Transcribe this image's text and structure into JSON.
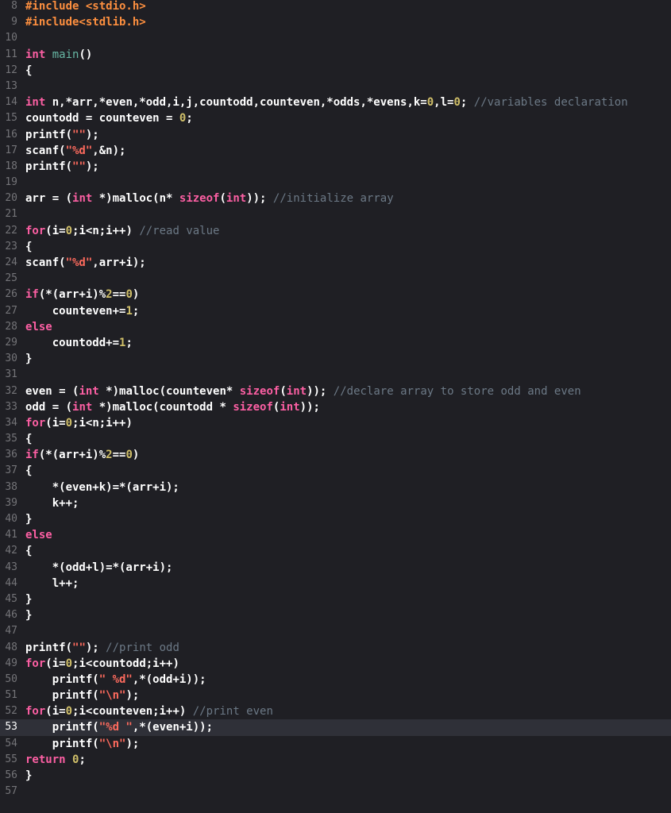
{
  "editor": {
    "current_line": 53,
    "lines": [
      {
        "n": "8",
        "t": [
          [
            "pp",
            "#include <stdio.h>"
          ]
        ]
      },
      {
        "n": "9",
        "t": [
          [
            "pp",
            "#include<stdlib.h>"
          ]
        ]
      },
      {
        "n": "10",
        "t": []
      },
      {
        "n": "11",
        "t": [
          [
            "kw",
            "int"
          ],
          [
            "pl",
            " "
          ],
          [
            "fn",
            "main"
          ],
          [
            "pl",
            "()"
          ]
        ]
      },
      {
        "n": "12",
        "t": [
          [
            "pl",
            "{"
          ]
        ]
      },
      {
        "n": "13",
        "t": []
      },
      {
        "n": "14",
        "t": [
          [
            "kw",
            "int"
          ],
          [
            "pl",
            " n,*arr,*even,*odd,i,j,countodd,counteven,*odds,*evens,k="
          ],
          [
            "num",
            "0"
          ],
          [
            "pl",
            ",l="
          ],
          [
            "num",
            "0"
          ],
          [
            "pl",
            "; "
          ],
          [
            "cm",
            "//variables declaration"
          ]
        ]
      },
      {
        "n": "15",
        "t": [
          [
            "pl",
            "countodd = counteven = "
          ],
          [
            "num",
            "0"
          ],
          [
            "pl",
            ";"
          ]
        ]
      },
      {
        "n": "16",
        "t": [
          [
            "pl",
            "printf("
          ],
          [
            "str",
            "\"\""
          ],
          [
            "pl",
            ");"
          ]
        ]
      },
      {
        "n": "17",
        "t": [
          [
            "pl",
            "scanf("
          ],
          [
            "str",
            "\"%d\""
          ],
          [
            "pl",
            ",&n);"
          ]
        ]
      },
      {
        "n": "18",
        "t": [
          [
            "pl",
            "printf("
          ],
          [
            "str",
            "\"\""
          ],
          [
            "pl",
            ");"
          ]
        ]
      },
      {
        "n": "19",
        "t": []
      },
      {
        "n": "20",
        "t": [
          [
            "pl",
            "arr = ("
          ],
          [
            "kw",
            "int"
          ],
          [
            "pl",
            " *)malloc(n* "
          ],
          [
            "kw",
            "sizeof"
          ],
          [
            "pl",
            "("
          ],
          [
            "kw",
            "int"
          ],
          [
            "pl",
            ")); "
          ],
          [
            "cm",
            "//initialize array"
          ]
        ]
      },
      {
        "n": "21",
        "t": []
      },
      {
        "n": "22",
        "t": [
          [
            "kw",
            "for"
          ],
          [
            "pl",
            "(i="
          ],
          [
            "num",
            "0"
          ],
          [
            "pl",
            ";i<n;i++) "
          ],
          [
            "cm",
            "//read value"
          ]
        ]
      },
      {
        "n": "23",
        "t": [
          [
            "pl",
            "{"
          ]
        ]
      },
      {
        "n": "24",
        "t": [
          [
            "pl",
            "scanf("
          ],
          [
            "str",
            "\"%d\""
          ],
          [
            "pl",
            ",arr+i);"
          ]
        ]
      },
      {
        "n": "25",
        "t": []
      },
      {
        "n": "26",
        "t": [
          [
            "kw",
            "if"
          ],
          [
            "pl",
            "(*(arr+i)%"
          ],
          [
            "num",
            "2"
          ],
          [
            "pl",
            "=="
          ],
          [
            "num",
            "0"
          ],
          [
            "pl",
            ")"
          ]
        ]
      },
      {
        "n": "27",
        "t": [
          [
            "pl",
            "    counteven+="
          ],
          [
            "num",
            "1"
          ],
          [
            "pl",
            ";"
          ]
        ]
      },
      {
        "n": "28",
        "t": [
          [
            "kw",
            "else"
          ]
        ]
      },
      {
        "n": "29",
        "t": [
          [
            "pl",
            "    countodd+="
          ],
          [
            "num",
            "1"
          ],
          [
            "pl",
            ";"
          ]
        ]
      },
      {
        "n": "30",
        "t": [
          [
            "pl",
            "}"
          ]
        ]
      },
      {
        "n": "31",
        "t": []
      },
      {
        "n": "32",
        "t": [
          [
            "pl",
            "even = ("
          ],
          [
            "kw",
            "int"
          ],
          [
            "pl",
            " *)malloc(counteven* "
          ],
          [
            "kw",
            "sizeof"
          ],
          [
            "pl",
            "("
          ],
          [
            "kw",
            "int"
          ],
          [
            "pl",
            ")); "
          ],
          [
            "cm",
            "//declare array to store odd and even"
          ]
        ]
      },
      {
        "n": "33",
        "t": [
          [
            "pl",
            "odd = ("
          ],
          [
            "kw",
            "int"
          ],
          [
            "pl",
            " *)malloc(countodd * "
          ],
          [
            "kw",
            "sizeof"
          ],
          [
            "pl",
            "("
          ],
          [
            "kw",
            "int"
          ],
          [
            "pl",
            "));"
          ]
        ]
      },
      {
        "n": "34",
        "t": [
          [
            "kw",
            "for"
          ],
          [
            "pl",
            "(i="
          ],
          [
            "num",
            "0"
          ],
          [
            "pl",
            ";i<n;i++)"
          ]
        ]
      },
      {
        "n": "35",
        "t": [
          [
            "pl",
            "{"
          ]
        ]
      },
      {
        "n": "36",
        "t": [
          [
            "kw",
            "if"
          ],
          [
            "pl",
            "(*(arr+i)%"
          ],
          [
            "num",
            "2"
          ],
          [
            "pl",
            "=="
          ],
          [
            "num",
            "0"
          ],
          [
            "pl",
            ")"
          ]
        ]
      },
      {
        "n": "37",
        "t": [
          [
            "pl",
            "{"
          ]
        ]
      },
      {
        "n": "38",
        "t": [
          [
            "pl",
            "    *(even+k)=*(arr+i);"
          ]
        ]
      },
      {
        "n": "39",
        "t": [
          [
            "pl",
            "    k++;"
          ]
        ]
      },
      {
        "n": "40",
        "t": [
          [
            "pl",
            "}"
          ]
        ]
      },
      {
        "n": "41",
        "t": [
          [
            "kw",
            "else"
          ]
        ]
      },
      {
        "n": "42",
        "t": [
          [
            "pl",
            "{"
          ]
        ]
      },
      {
        "n": "43",
        "t": [
          [
            "pl",
            "    *(odd+l)=*(arr+i);"
          ]
        ]
      },
      {
        "n": "44",
        "t": [
          [
            "pl",
            "    l++;"
          ]
        ]
      },
      {
        "n": "45",
        "t": [
          [
            "pl",
            "}"
          ]
        ]
      },
      {
        "n": "46",
        "t": [
          [
            "pl",
            "}"
          ]
        ]
      },
      {
        "n": "47",
        "t": []
      },
      {
        "n": "48",
        "t": [
          [
            "pl",
            "printf("
          ],
          [
            "str",
            "\"\""
          ],
          [
            "pl",
            "); "
          ],
          [
            "cm",
            "//print odd"
          ]
        ]
      },
      {
        "n": "49",
        "t": [
          [
            "kw",
            "for"
          ],
          [
            "pl",
            "(i="
          ],
          [
            "num",
            "0"
          ],
          [
            "pl",
            ";i<countodd;i++)"
          ]
        ]
      },
      {
        "n": "50",
        "t": [
          [
            "pl",
            "    printf("
          ],
          [
            "str",
            "\" %d\""
          ],
          [
            "pl",
            ",*(odd+i));"
          ]
        ]
      },
      {
        "n": "51",
        "t": [
          [
            "pl",
            "    printf("
          ],
          [
            "str",
            "\"\\n\""
          ],
          [
            "pl",
            ");"
          ]
        ]
      },
      {
        "n": "52",
        "t": [
          [
            "kw",
            "for"
          ],
          [
            "pl",
            "(i="
          ],
          [
            "num",
            "0"
          ],
          [
            "pl",
            ";i<counteven;i++) "
          ],
          [
            "cm",
            "//print even"
          ]
        ]
      },
      {
        "n": "53",
        "t": [
          [
            "pl",
            "    printf("
          ],
          [
            "str",
            "\"%d \""
          ],
          [
            "pl",
            ",*(even+i));"
          ]
        ]
      },
      {
        "n": "54",
        "t": [
          [
            "pl",
            "    printf("
          ],
          [
            "str",
            "\"\\n\""
          ],
          [
            "pl",
            ");"
          ]
        ]
      },
      {
        "n": "55",
        "t": [
          [
            "kw",
            "return"
          ],
          [
            "pl",
            " "
          ],
          [
            "num",
            "0"
          ],
          [
            "pl",
            ";"
          ]
        ]
      },
      {
        "n": "56",
        "t": [
          [
            "pl",
            "}"
          ]
        ]
      },
      {
        "n": "57",
        "t": []
      }
    ]
  },
  "theme": {
    "background": "#1f1f24",
    "current_line_background": "#2f3038",
    "keyword": "#fc5fa3",
    "preprocessor": "#fd8f3f",
    "string": "#fc6a5d",
    "number": "#d0bf69",
    "comment": "#6c7986",
    "function": "#67b7a4",
    "plain": "#ffffff",
    "line_number": "#747478"
  }
}
